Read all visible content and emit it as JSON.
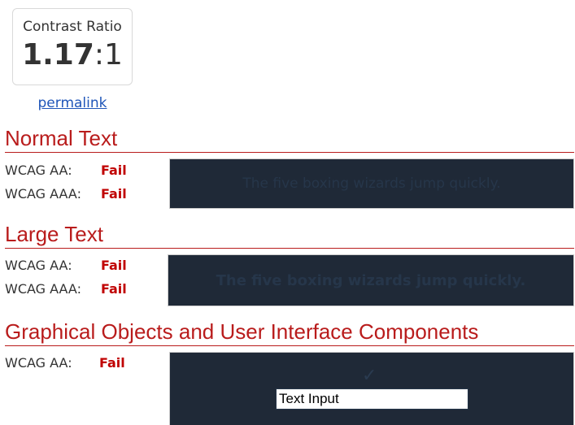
{
  "ratio": {
    "label": "Contrast Ratio",
    "value_main": "1.17",
    "value_suffix": ":1"
  },
  "permalink": "permalink",
  "sections": {
    "normal": {
      "title": "Normal Text",
      "rows": [
        {
          "label": "WCAG AA:",
          "result": "Fail"
        },
        {
          "label": "WCAG AAA:",
          "result": "Fail"
        }
      ],
      "sample_text": "The five boxing wizards jump quickly."
    },
    "large": {
      "title": "Large Text",
      "rows": [
        {
          "label": "WCAG AA:",
          "result": "Fail"
        },
        {
          "label": "WCAG AAA:",
          "result": "Fail"
        }
      ],
      "sample_text": "The five boxing wizards jump quickly."
    },
    "graphical": {
      "title": "Graphical Objects and User Interface Components",
      "rows": [
        {
          "label": "WCAG AA:",
          "result": "Fail"
        }
      ],
      "checkmark": "✓",
      "input_value": "Text Input"
    }
  },
  "colors": {
    "foreground": "#26364a",
    "background": "#1f2937",
    "fail": "#c00000",
    "heading": "#b91c1c",
    "link": "#2056b9"
  }
}
